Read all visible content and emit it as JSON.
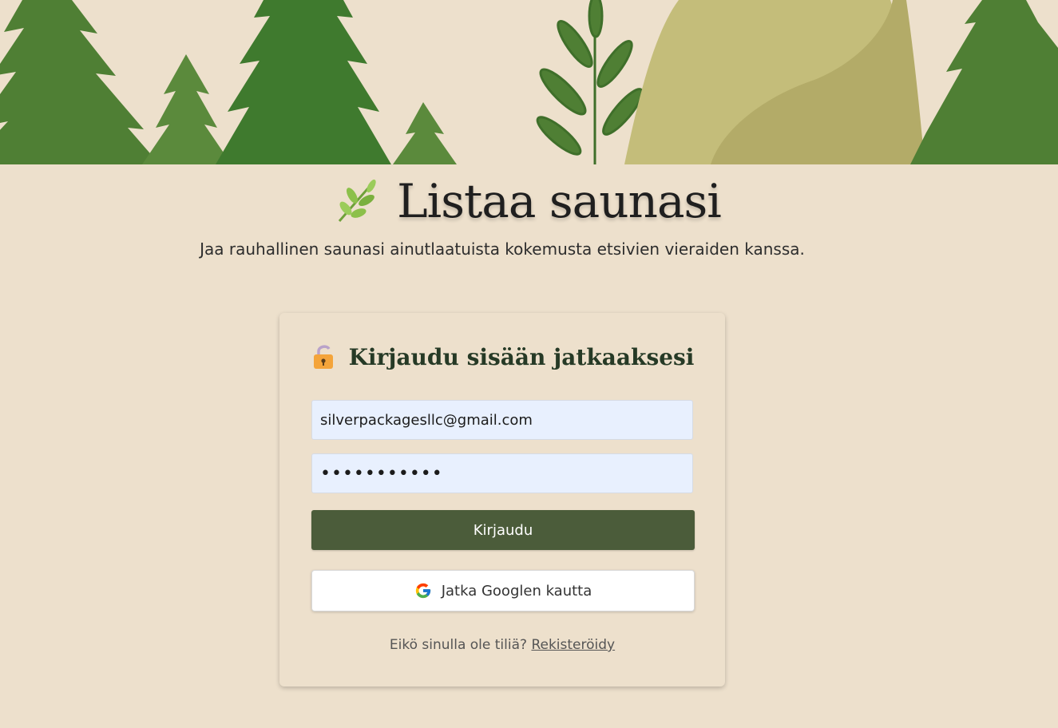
{
  "page": {
    "title": "Listaa saunasi",
    "subtitle": "Jaa rauhallinen saunasi ainutlaatuista kokemusta etsivien vieraiden kanssa."
  },
  "login_card": {
    "title": "Kirjaudu sisään jatkaaksesi",
    "email_value": "silverpackagesllc@gmail.com",
    "password_value": "•••••••••••",
    "login_button": "Kirjaudu",
    "google_button": "Jatka Googlen kautta",
    "signup_prompt": "Eikö sinulla ole tiliä?",
    "signup_link": "Rekisteröidy"
  },
  "icons": {
    "heading": "herb-icon",
    "card_title": "lock-icon",
    "google": "google-icon"
  },
  "colors": {
    "background": "#ede0cc",
    "primary_button": "#4b5c3a",
    "title_text": "#263a26",
    "input_background": "#e8f0fe",
    "tree_green": "#4f7f34"
  }
}
